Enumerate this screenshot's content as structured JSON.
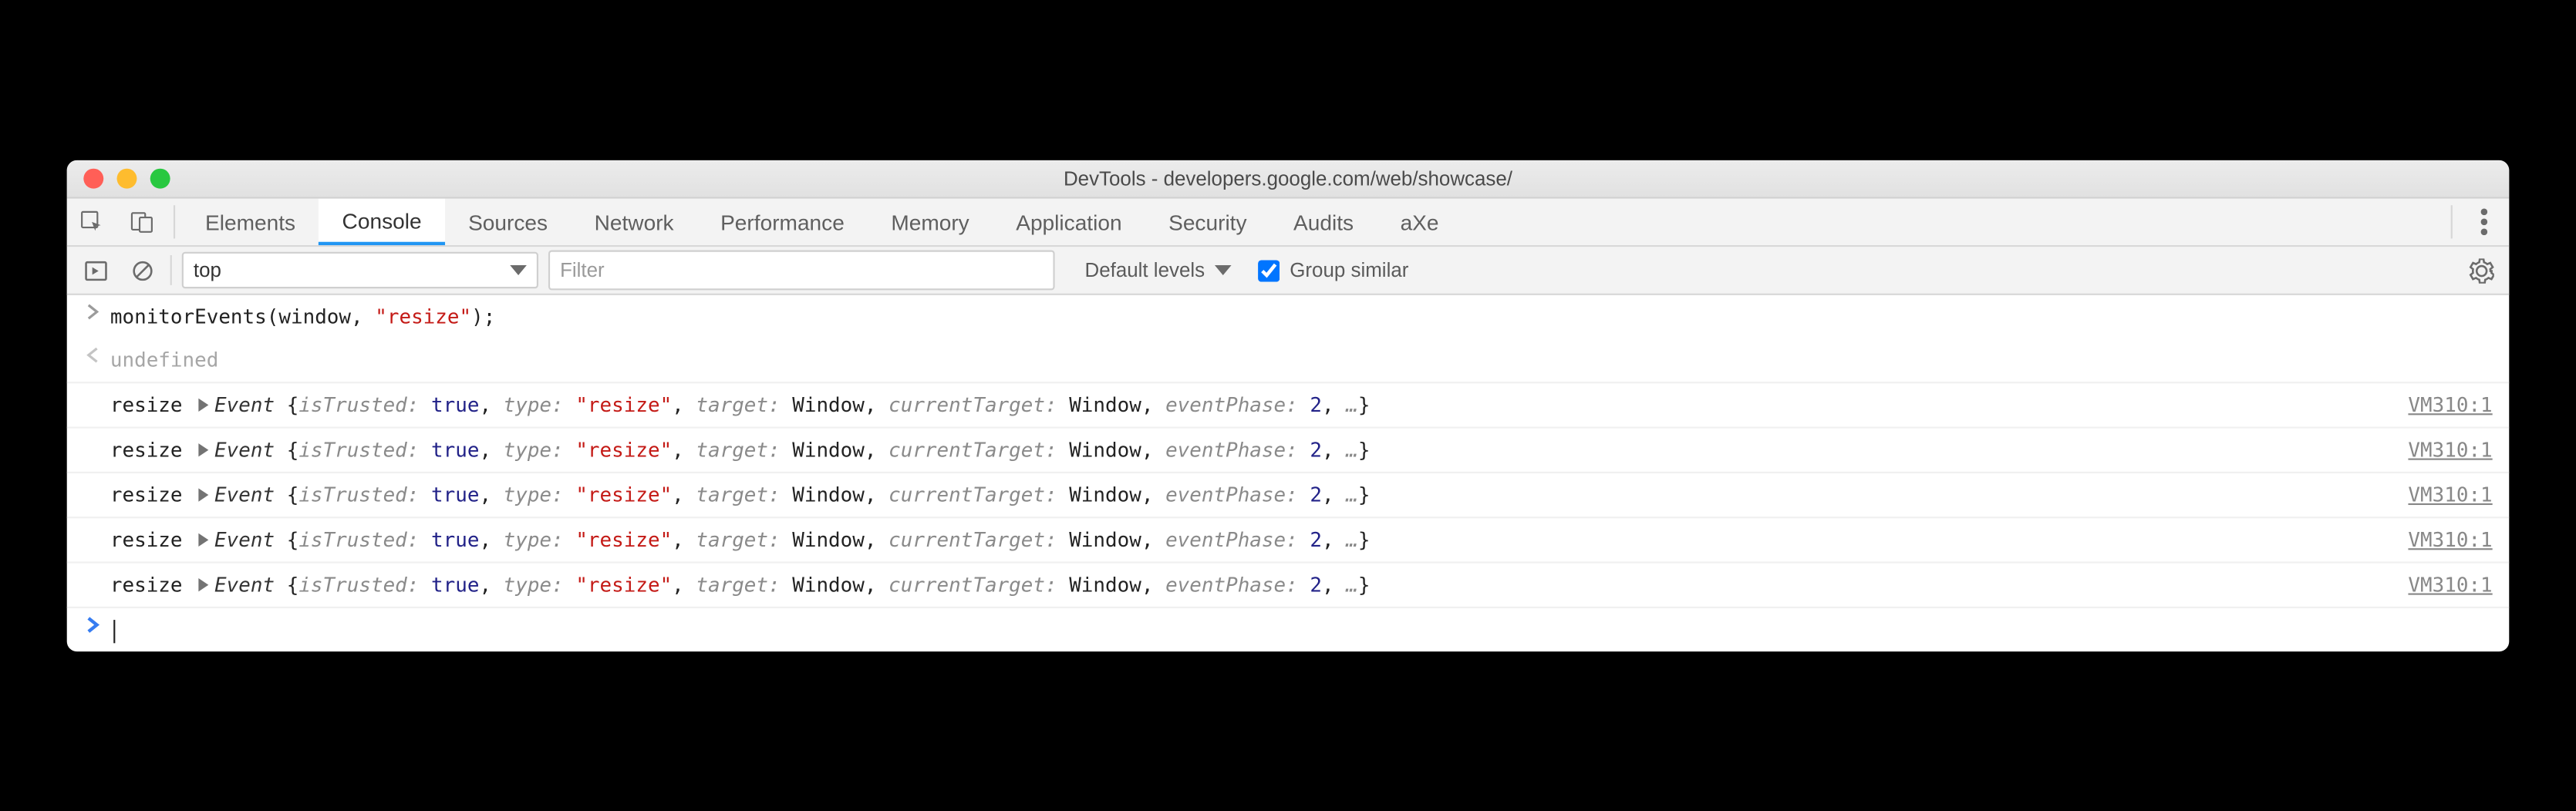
{
  "titlebar": {
    "title": "DevTools - developers.google.com/web/showcase/"
  },
  "tabs": {
    "items": [
      {
        "label": "Elements",
        "active": false
      },
      {
        "label": "Console",
        "active": true
      },
      {
        "label": "Sources",
        "active": false
      },
      {
        "label": "Network",
        "active": false
      },
      {
        "label": "Performance",
        "active": false
      },
      {
        "label": "Memory",
        "active": false
      },
      {
        "label": "Application",
        "active": false
      },
      {
        "label": "Security",
        "active": false
      },
      {
        "label": "Audits",
        "active": false
      },
      {
        "label": "aXe",
        "active": false
      }
    ]
  },
  "console_toolbar": {
    "context": "top",
    "filter_placeholder": "Filter",
    "levels_label": "Default levels",
    "group_similar_label": "Group similar",
    "group_similar_checked": true
  },
  "console": {
    "input_line": {
      "func": "monitorEvents",
      "open": "(",
      "arg1": "window",
      "comma": ", ",
      "arg2": "\"resize\"",
      "close": ");"
    },
    "result": "undefined",
    "events": [
      {
        "name": "resize",
        "source": "VM310:1",
        "obj": {
          "cls": "Event",
          "pairs": [
            [
              "isTrusted:",
              "true",
              "bool"
            ],
            [
              "type:",
              "\"resize\"",
              "strv"
            ],
            [
              "target:",
              "Window",
              "val"
            ],
            [
              "currentTarget:",
              "Window",
              "val"
            ],
            [
              "eventPhase:",
              "2",
              "num"
            ]
          ]
        }
      },
      {
        "name": "resize",
        "source": "VM310:1",
        "obj": {
          "cls": "Event",
          "pairs": [
            [
              "isTrusted:",
              "true",
              "bool"
            ],
            [
              "type:",
              "\"resize\"",
              "strv"
            ],
            [
              "target:",
              "Window",
              "val"
            ],
            [
              "currentTarget:",
              "Window",
              "val"
            ],
            [
              "eventPhase:",
              "2",
              "num"
            ]
          ]
        }
      },
      {
        "name": "resize",
        "source": "VM310:1",
        "obj": {
          "cls": "Event",
          "pairs": [
            [
              "isTrusted:",
              "true",
              "bool"
            ],
            [
              "type:",
              "\"resize\"",
              "strv"
            ],
            [
              "target:",
              "Window",
              "val"
            ],
            [
              "currentTarget:",
              "Window",
              "val"
            ],
            [
              "eventPhase:",
              "2",
              "num"
            ]
          ]
        }
      },
      {
        "name": "resize",
        "source": "VM310:1",
        "obj": {
          "cls": "Event",
          "pairs": [
            [
              "isTrusted:",
              "true",
              "bool"
            ],
            [
              "type:",
              "\"resize\"",
              "strv"
            ],
            [
              "target:",
              "Window",
              "val"
            ],
            [
              "currentTarget:",
              "Window",
              "val"
            ],
            [
              "eventPhase:",
              "2",
              "num"
            ]
          ]
        }
      },
      {
        "name": "resize",
        "source": "VM310:1",
        "obj": {
          "cls": "Event",
          "pairs": [
            [
              "isTrusted:",
              "true",
              "bool"
            ],
            [
              "type:",
              "\"resize\"",
              "strv"
            ],
            [
              "target:",
              "Window",
              "val"
            ],
            [
              "currentTarget:",
              "Window",
              "val"
            ],
            [
              "eventPhase:",
              "2",
              "num"
            ]
          ]
        }
      }
    ]
  }
}
